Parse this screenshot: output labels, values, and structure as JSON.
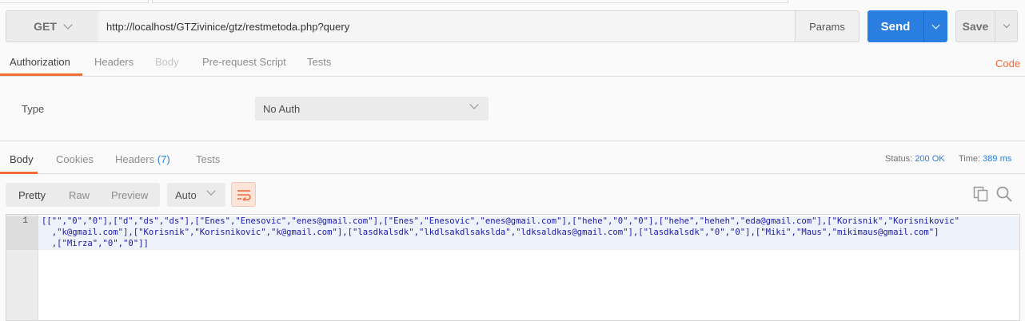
{
  "request": {
    "method": "GET",
    "url": "http://localhost/GTZivinice/gtz/restmetoda.php?query",
    "params_label": "Params",
    "send_label": "Send",
    "save_label": "Save"
  },
  "request_tabs": [
    {
      "label": "Authorization",
      "state": "active"
    },
    {
      "label": "Headers",
      "state": "normal"
    },
    {
      "label": "Body",
      "state": "disabled"
    },
    {
      "label": "Pre-request Script",
      "state": "normal"
    },
    {
      "label": "Tests",
      "state": "normal"
    }
  ],
  "code_link": "Code",
  "auth": {
    "type_label": "Type",
    "type_value": "No Auth"
  },
  "response_tabs": {
    "body": "Body",
    "cookies": "Cookies",
    "headers": "Headers",
    "headers_count": "(7)",
    "tests": "Tests"
  },
  "status": {
    "status_label": "Status:",
    "status_value": "200 OK",
    "time_label": "Time:",
    "time_value": "389 ms"
  },
  "view_modes": [
    "Pretty",
    "Raw",
    "Preview"
  ],
  "format_select": "Auto",
  "response_body": {
    "line_number": "1",
    "lines": [
      "[[\"\",\"0\",\"0\"],[\"d\",\"ds\",\"ds\"],[\"Enes\",\"Enesovic\",\"enes@gmail.com\"],[\"Enes\",\"Enesovic\",\"enes@gmail.com\"],[\"hehe\",\"0\",\"0\"],[\"hehe\",\"heheh\",\"eda@gmail.com\"],[\"Korisnik\",\"Korisnikovic\"",
      "  ,\"k@gmail.com\"],[\"Korisnik\",\"Korisnikovic\",\"k@gmail.com\"],[\"lasdkalsdk\",\"lkdlsakdlsakslda\",\"ldksaldkas@gmail.com\"],[\"lasdkalsdk\",\"0\",\"0\"],[\"Miki\",\"Maus\",\"mikimaus@gmail.com\"]",
      "  ,[\"Mirza\",\"0\",\"0\"]]"
    ]
  },
  "colors": {
    "accent": "#f26b3a",
    "primary": "#2a7ee0"
  }
}
